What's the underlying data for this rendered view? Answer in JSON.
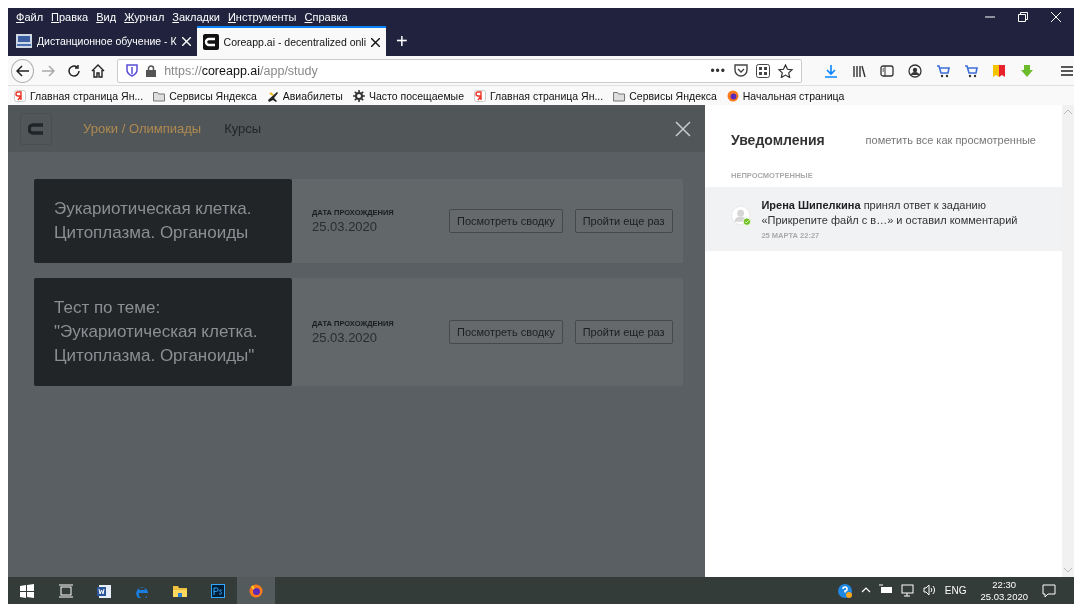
{
  "menu": [
    {
      "label": "Файл"
    },
    {
      "label": "Правка"
    },
    {
      "label": "Вид"
    },
    {
      "label": "Журнал"
    },
    {
      "label": "Закладки"
    },
    {
      "label": "Инструменты"
    },
    {
      "label": "Справка"
    }
  ],
  "tabs": [
    {
      "title": "Дистанционное обучение - К",
      "kind": "classroom",
      "selected": false
    },
    {
      "title": "Coreapp.ai - decentralized onli",
      "kind": "coreapp",
      "selected": true
    }
  ],
  "new_tab": "+",
  "address_bar": {
    "scheme": "https://",
    "domain": "coreapp.ai",
    "path": "/app/study",
    "page_actions": "•••"
  },
  "bookmarks": [
    {
      "label": "Главная страница Ян...",
      "kind": "yandex"
    },
    {
      "label": "Сервисы Яндекса",
      "kind": "folder"
    },
    {
      "label": "Авиабилеты",
      "kind": "plane"
    },
    {
      "label": "Часто посещаемые",
      "kind": "gear"
    },
    {
      "label": "Главная страница Ян...",
      "kind": "yandex"
    },
    {
      "label": "Сервисы Яндекса",
      "kind": "folder"
    },
    {
      "label": "Начальная страница",
      "kind": "firefox"
    }
  ],
  "app": {
    "nav": [
      {
        "label": "Уроки / Олимпиады",
        "selected": true
      },
      {
        "label": "Курсы",
        "selected": false
      }
    ],
    "results": [
      {
        "title": "Эукариотическая клетка. Цитоплазма. Органоиды",
        "date_label": "ДАТА ПРОХОЖДЕНИЯ",
        "date": "25.03.2020",
        "buttons": [
          "Посмотреть сводку",
          "Пройти еще раз"
        ]
      },
      {
        "title": "Тест по теме: \"Эукариотическая клетка. Цитоплазма. Органоиды\"",
        "date_label": "ДАТА ПРОХОЖДЕНИЯ",
        "date": "25.03.2020",
        "buttons": [
          "Посмотреть сводку",
          "Пройти еще раз"
        ]
      }
    ]
  },
  "notifications": {
    "title": "Уведомления",
    "mark_all": "пометить все как просмотренные",
    "section": "НЕПРОСМОТРЕННЫЕ",
    "items": [
      {
        "text": "**Ирена Шипелкина** принял ответ к заданию «Прикрепите файл с в…» и оставил комментарий",
        "time": "25 МАРТА 22:27",
        "unread": true
      }
    ]
  },
  "taskbar": {
    "apps": [
      {
        "kind": "taskview",
        "selected": false
      },
      {
        "kind": "word",
        "selected": false
      },
      {
        "kind": "edge",
        "selected": false
      },
      {
        "kind": "explorer",
        "selected": false
      },
      {
        "kind": "photoshop",
        "selected": false
      },
      {
        "kind": "firefox",
        "selected": true
      }
    ],
    "language": "ENG",
    "time": "22:30",
    "date": "25.03.2020"
  }
}
